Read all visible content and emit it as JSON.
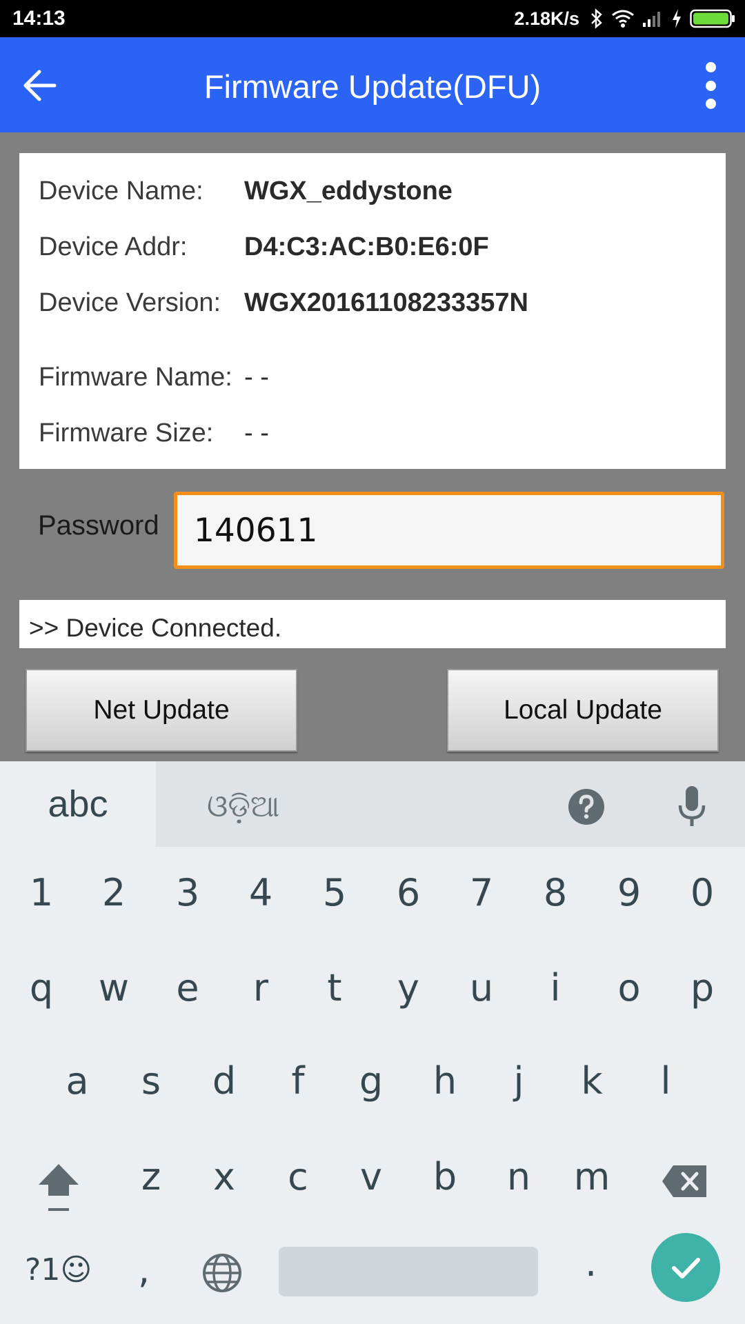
{
  "status_bar": {
    "time": "14:13",
    "net_speed": "2.18K/s",
    "icons": [
      "bluetooth-icon",
      "wifi-icon",
      "signal-icon",
      "charging-icon",
      "battery-icon"
    ]
  },
  "app_bar": {
    "title": "Firmware Update(DFU)",
    "color": "#2b63f5",
    "icons": [
      "back-arrow-icon",
      "overflow-menu-icon"
    ]
  },
  "device_info": {
    "device_name_label": "Device Name:",
    "device_name": "WGX_eddystone",
    "device_addr_label": "Device Addr:",
    "device_addr": "D4:C3:AC:B0:E6:0F",
    "device_version_label": "Device Version:",
    "device_version": "WGX20161108233357N",
    "firmware_name_label": "Firmware Name:",
    "firmware_name": "- -",
    "firmware_size_label": "Firmware Size:",
    "firmware_size": "- -"
  },
  "password": {
    "label": "Password",
    "value": "140611",
    "focus_color": "#f39019"
  },
  "log": {
    "text": ">> Device Connected."
  },
  "buttons": {
    "net_update": "Net Update",
    "local_update": "Local Update"
  },
  "keyboard": {
    "tab_abc": "abc",
    "tab_script": "ଓଡ଼ିଆ",
    "number_row": [
      "1",
      "2",
      "3",
      "4",
      "5",
      "6",
      "7",
      "8",
      "9",
      "0"
    ],
    "row1": [
      "q",
      "w",
      "e",
      "r",
      "t",
      "y",
      "u",
      "i",
      "o",
      "p"
    ],
    "row2": [
      "a",
      "s",
      "d",
      "f",
      "g",
      "h",
      "j",
      "k",
      "l"
    ],
    "row3": [
      "z",
      "x",
      "c",
      "v",
      "b",
      "n",
      "m"
    ],
    "symbols_label": "?1☺",
    "comma": ",",
    "period": ".",
    "accent_color": "#3fb3a7",
    "icons": [
      "help-icon",
      "mic-icon",
      "shift-icon",
      "backspace-icon",
      "globe-icon",
      "check-icon"
    ]
  }
}
